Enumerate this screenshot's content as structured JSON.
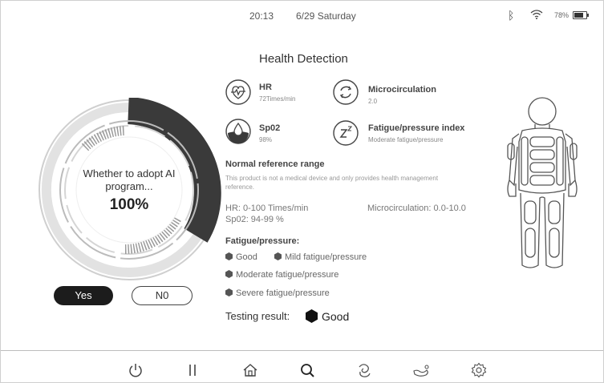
{
  "status": {
    "time": "20:13",
    "date": "6/29 Saturday",
    "battery": "78%",
    "battery_level": 0.78,
    "icons": [
      "bluetooth-icon",
      "wifi-icon",
      "battery-icon"
    ]
  },
  "title": "Health Detection",
  "ring": {
    "question": "Whether to adopt AI program...",
    "percent": "100%",
    "progress": 1.0
  },
  "buttons": {
    "yes": "Yes",
    "no": "N0"
  },
  "metrics": [
    {
      "label": "HR",
      "sub": "72Times/min",
      "icon": "heart-rate-icon"
    },
    {
      "label": "Microcirculation",
      "sub": "2.0",
      "icon": "circulation-icon"
    },
    {
      "label": "Sp02",
      "sub": "98%",
      "icon": "oxygen-drop-icon"
    },
    {
      "label": "Fatigue/pressure index",
      "sub": "Moderate fatigue/pressure",
      "icon": "sleep-zz-icon"
    }
  ],
  "reference": {
    "title": "Normal reference range",
    "description": "This product is not a medical device and only provides health management reference.",
    "hr": "HR: 0-100 Times/min",
    "sp02": "Sp02: 94-99 %",
    "micro": "Microcirculation: 0.0-10.0"
  },
  "fatigue": {
    "title": "Fatigue/pressure:",
    "levels": [
      "Good",
      "Mild fatigue/pressure",
      "Moderate fatigue/pressure",
      "Severe fatigue/pressure"
    ]
  },
  "result": {
    "label": "Testing result:",
    "value": "Good"
  },
  "nav": [
    "power-icon",
    "pause-icon",
    "home-icon",
    "search-icon",
    "massage-icon",
    "foot-icon",
    "settings-icon"
  ],
  "colors": {
    "accent": "#3a3a3a",
    "ring_light": "#e0e0e0",
    "button_dark": "#1c1c1c"
  }
}
